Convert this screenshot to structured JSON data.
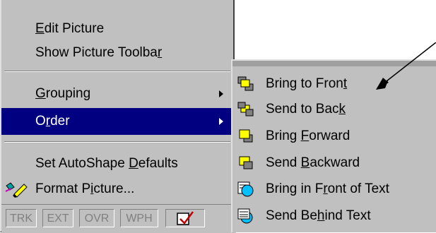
{
  "main_menu": {
    "items": [
      {
        "pre": "",
        "u": "E",
        "post": "dit Picture"
      },
      {
        "pre": "Show Picture Toolba",
        "u": "r",
        "post": ""
      },
      {
        "pre": "",
        "u": "G",
        "post": "rouping"
      },
      {
        "pre": "O",
        "u": "r",
        "post": "der"
      },
      {
        "pre": "Set AutoShape ",
        "u": "D",
        "post": "efaults"
      },
      {
        "pre": "Format P",
        "u": "i",
        "post": "cture..."
      }
    ]
  },
  "sub_menu": {
    "items": [
      {
        "pre": "Bring to Fron",
        "u": "t",
        "post": ""
      },
      {
        "pre": "Send to Bac",
        "u": "k",
        "post": ""
      },
      {
        "pre": "Bring ",
        "u": "F",
        "post": "orward"
      },
      {
        "pre": "Send ",
        "u": "B",
        "post": "ackward"
      },
      {
        "pre": "Bring in F",
        "u": "r",
        "post": "ont of Text"
      },
      {
        "pre": "Send Be",
        "u": "h",
        "post": "ind Text"
      }
    ]
  },
  "status_bar": {
    "boxes": [
      "TRK",
      "EXT",
      "OVR",
      "WPH"
    ]
  },
  "colors": {
    "menu_bg": "#c0c0c0",
    "highlight": "#000080"
  }
}
